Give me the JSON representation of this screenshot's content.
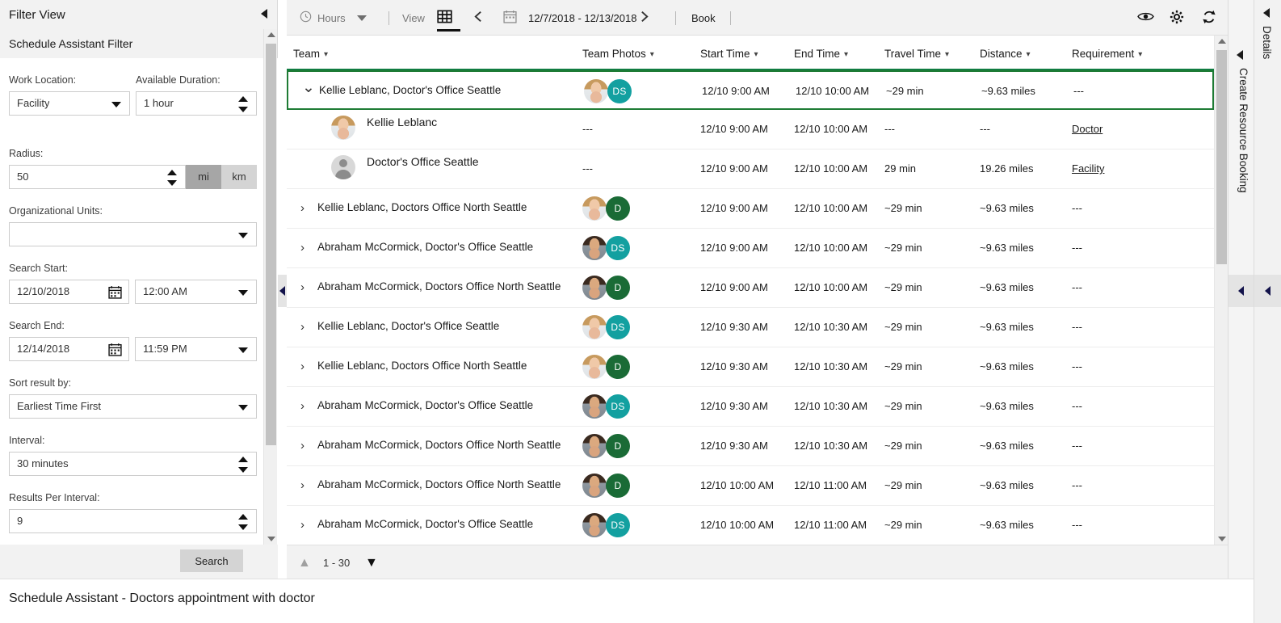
{
  "filter": {
    "title": "Filter View",
    "subtitle": "Schedule Assistant Filter",
    "work_location": {
      "label": "Work Location:",
      "value": "Facility"
    },
    "available_duration": {
      "label": "Available Duration:",
      "value": "1 hour"
    },
    "radius": {
      "label": "Radius:",
      "value": "50",
      "unit_mi": "mi",
      "unit_km": "km",
      "selected_unit": "mi"
    },
    "organizational_units": {
      "label": "Organizational Units:",
      "value": ""
    },
    "search_start": {
      "label": "Search Start:",
      "date": "12/10/2018",
      "time": "12:00 AM"
    },
    "search_end": {
      "label": "Search End:",
      "date": "12/14/2018",
      "time": "11:59 PM"
    },
    "sort_result_by": {
      "label": "Sort result by:",
      "value": "Earliest Time First"
    },
    "interval": {
      "label": "Interval:",
      "value": "30 minutes"
    },
    "results_per_interval": {
      "label": "Results Per Interval:",
      "value": "9"
    },
    "search_button": "Search"
  },
  "toolbar": {
    "hours_label": "Hours",
    "view_label": "View",
    "date_range": "12/7/2018 - 12/13/2018",
    "book_label": "Book",
    "icons": [
      "clock-icon",
      "chevron-down-icon",
      "grid-view-icon",
      "prev-arrow-icon",
      "calendar-icon",
      "next-arrow-icon",
      "eye-icon",
      "gear-icon",
      "refresh-icon"
    ]
  },
  "grid": {
    "columns": [
      "Team",
      "Team Photos",
      "Start Time",
      "End Time",
      "Travel Time",
      "Distance",
      "Requirement"
    ],
    "rows": [
      {
        "type": "group",
        "expanded": true,
        "selected": true,
        "team": "Kellie Leblanc, Doctor's Office Seattle",
        "avatar": "kellie",
        "badge": "DS",
        "badge_color": "#13a0a0",
        "start": "12/10 9:00 AM",
        "end": "12/10 10:00 AM",
        "travel": "~29 min",
        "distance": "~9.63 miles",
        "requirement": "---"
      },
      {
        "type": "child",
        "avatar": "kellie",
        "team": "Kellie Leblanc",
        "photos": "---",
        "start": "12/10 9:00 AM",
        "end": "12/10 10:00 AM",
        "travel": "---",
        "distance": "---",
        "requirement": "Doctor",
        "requirement_link": true
      },
      {
        "type": "child",
        "avatar": "generic",
        "team": "Doctor's Office Seattle",
        "photos": "---",
        "start": "12/10 9:00 AM",
        "end": "12/10 10:00 AM",
        "travel": "29 min",
        "distance": "19.26 miles",
        "requirement": "Facility",
        "requirement_link": true
      },
      {
        "type": "group",
        "expanded": false,
        "team": "Kellie Leblanc, Doctors Office North Seattle",
        "avatar": "kellie",
        "badge": "D",
        "badge_color": "#1a6b36",
        "start": "12/10 9:00 AM",
        "end": "12/10 10:00 AM",
        "travel": "~29 min",
        "distance": "~9.63 miles",
        "requirement": "---"
      },
      {
        "type": "group",
        "expanded": false,
        "team": "Abraham McCormick, Doctor's Office Seattle",
        "avatar": "abraham",
        "badge": "DS",
        "badge_color": "#13a0a0",
        "start": "12/10 9:00 AM",
        "end": "12/10 10:00 AM",
        "travel": "~29 min",
        "distance": "~9.63 miles",
        "requirement": "---"
      },
      {
        "type": "group",
        "expanded": false,
        "team": "Abraham McCormick, Doctors Office North Seattle",
        "avatar": "abraham",
        "badge": "D",
        "badge_color": "#1a6b36",
        "start": "12/10 9:00 AM",
        "end": "12/10 10:00 AM",
        "travel": "~29 min",
        "distance": "~9.63 miles",
        "requirement": "---"
      },
      {
        "type": "group",
        "expanded": false,
        "team": "Kellie Leblanc, Doctor's Office Seattle",
        "avatar": "kellie",
        "badge": "DS",
        "badge_color": "#13a0a0",
        "start": "12/10 9:30 AM",
        "end": "12/10 10:30 AM",
        "travel": "~29 min",
        "distance": "~9.63 miles",
        "requirement": "---"
      },
      {
        "type": "group",
        "expanded": false,
        "team": "Kellie Leblanc, Doctors Office North Seattle",
        "avatar": "kellie",
        "badge": "D",
        "badge_color": "#1a6b36",
        "start": "12/10 9:30 AM",
        "end": "12/10 10:30 AM",
        "travel": "~29 min",
        "distance": "~9.63 miles",
        "requirement": "---"
      },
      {
        "type": "group",
        "expanded": false,
        "team": "Abraham McCormick, Doctor's Office Seattle",
        "avatar": "abraham",
        "badge": "DS",
        "badge_color": "#13a0a0",
        "start": "12/10 9:30 AM",
        "end": "12/10 10:30 AM",
        "travel": "~29 min",
        "distance": "~9.63 miles",
        "requirement": "---"
      },
      {
        "type": "group",
        "expanded": false,
        "team": "Abraham McCormick, Doctors Office North Seattle",
        "avatar": "abraham",
        "badge": "D",
        "badge_color": "#1a6b36",
        "start": "12/10 9:30 AM",
        "end": "12/10 10:30 AM",
        "travel": "~29 min",
        "distance": "~9.63 miles",
        "requirement": "---"
      },
      {
        "type": "group",
        "expanded": false,
        "team": "Abraham McCormick, Doctors Office North Seattle",
        "avatar": "abraham",
        "badge": "D",
        "badge_color": "#1a6b36",
        "start": "12/10 10:00 AM",
        "end": "12/10 11:00 AM",
        "travel": "~29 min",
        "distance": "~9.63 miles",
        "requirement": "---"
      },
      {
        "type": "group",
        "expanded": false,
        "team": "Abraham McCormick, Doctor's Office Seattle",
        "avatar": "abraham",
        "badge": "DS",
        "badge_color": "#13a0a0",
        "start": "12/10 10:00 AM",
        "end": "12/10 11:00 AM",
        "travel": "~29 min",
        "distance": "~9.63 miles",
        "requirement": "---"
      }
    ]
  },
  "pager": {
    "range": "1 - 30"
  },
  "right_panels": {
    "create_resource_booking": "Create Resource Booking",
    "details": "Details"
  },
  "statusbar": {
    "text": "Schedule Assistant - Doctors appointment with doctor"
  },
  "colors": {
    "accent_green": "#107c41",
    "selection_green": "#1e7b34",
    "badge_teal": "#13a0a0",
    "badge_green": "#1a6b36"
  }
}
